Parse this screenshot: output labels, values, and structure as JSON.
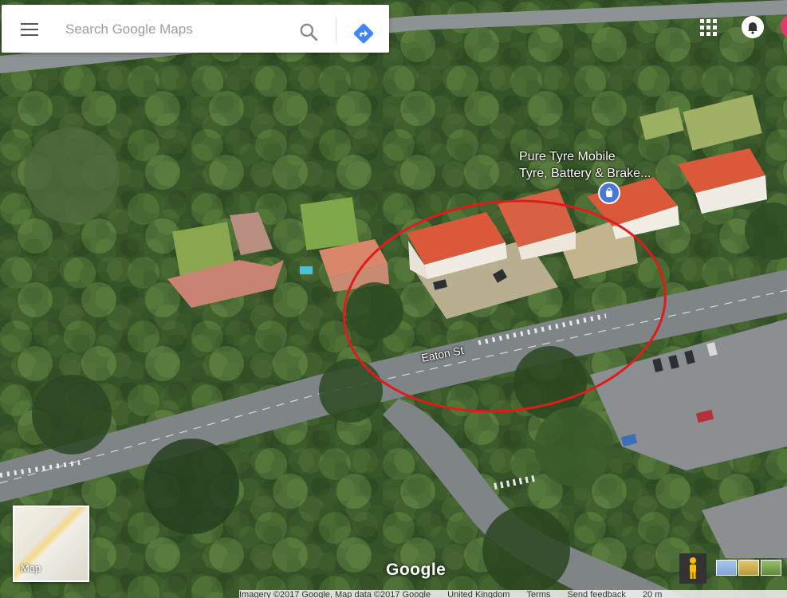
{
  "search": {
    "placeholder": "Search Google Maps"
  },
  "map": {
    "poi_name_line1": "Pure Tyre Mobile",
    "poi_name_line2": "Tyre, Battery & Brake...",
    "street_label": "Eaton St",
    "minimap_label": "Map",
    "logo_text": "Google",
    "annotation_color": "#e11b1b"
  },
  "footer": {
    "imagery": "Imagery ©2017 Google, Map data ©2017 Google",
    "region": "United Kingdom",
    "terms": "Terms",
    "feedback": "Send feedback",
    "scale": "20 m"
  },
  "icons": [
    "menu-icon",
    "search-icon",
    "directions-icon",
    "apps-icon",
    "notifications-icon",
    "shopping-pin-icon",
    "pegman-icon"
  ]
}
